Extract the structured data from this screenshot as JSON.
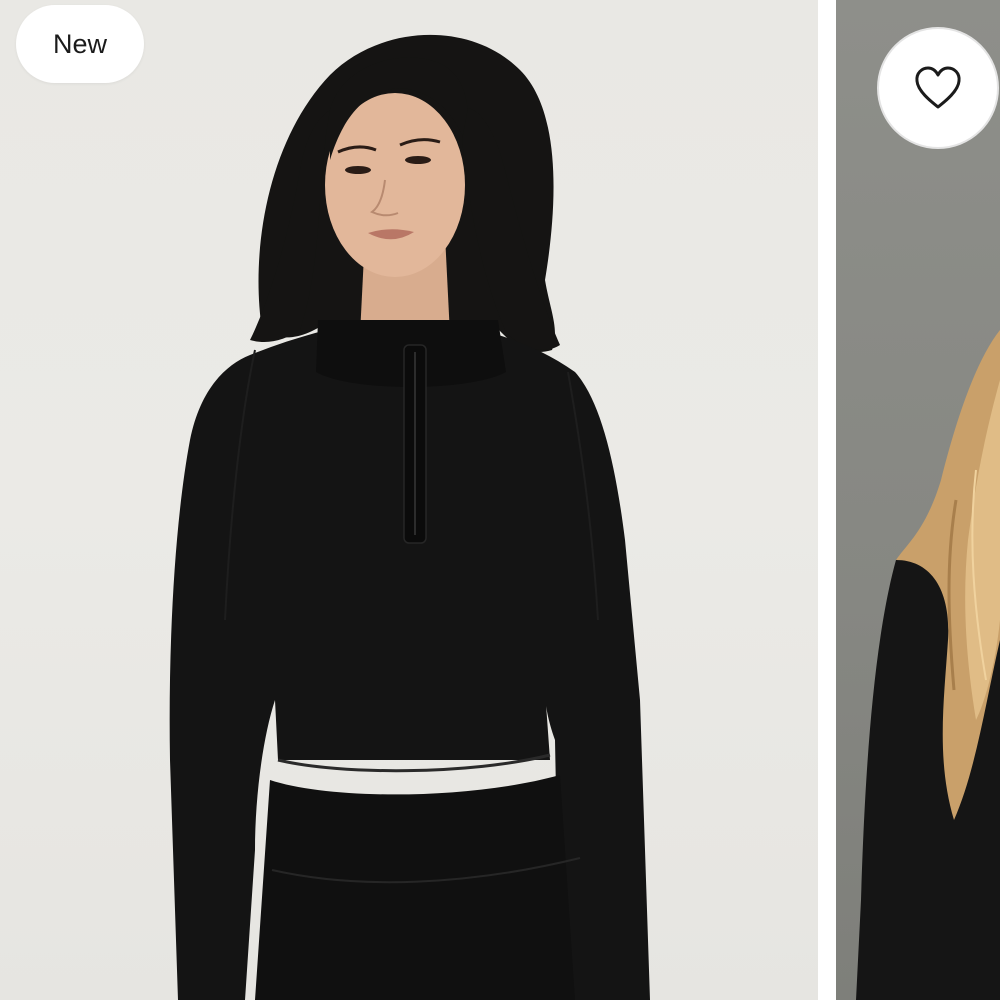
{
  "carousel": {
    "cards": [
      {
        "badge": {
          "label": "New"
        },
        "image": {
          "subject": "model-black-half-zip-long-sleeve-top"
        }
      },
      {
        "image": {
          "subject": "model-blonde-black-top"
        },
        "wishlist": {
          "icon": "heart-outline-icon"
        }
      }
    ]
  },
  "colors": {
    "background_main": "#e9e8e4",
    "background_next": "#8a8b86",
    "badge_bg": "#ffffff",
    "text": "#1b1b1b",
    "garment": "#121212"
  }
}
